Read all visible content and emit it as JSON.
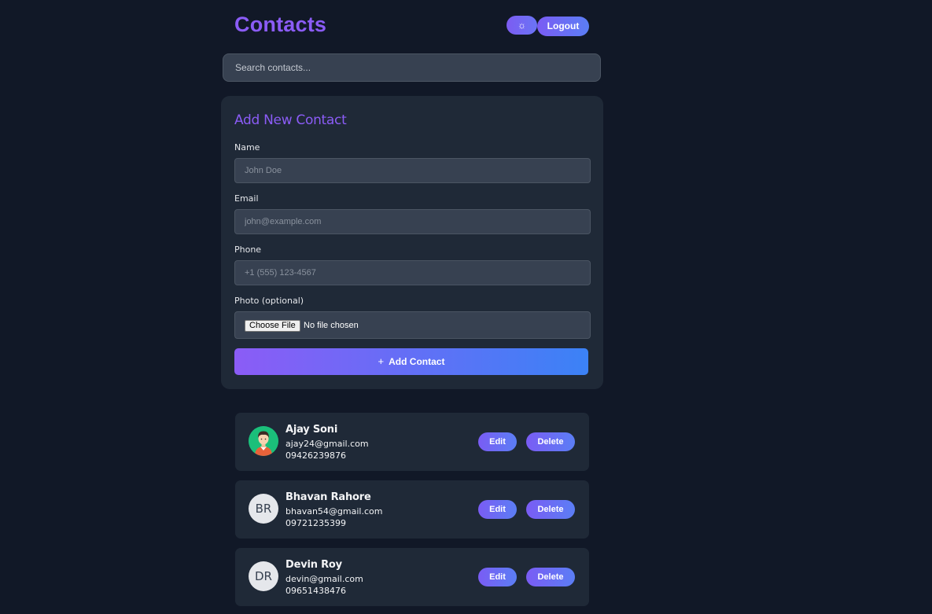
{
  "header": {
    "title": "Contacts",
    "theme_icon": "☼",
    "logout_label": "Logout"
  },
  "search": {
    "placeholder": "Search contacts..."
  },
  "form": {
    "title": "Add New Contact",
    "name_label": "Name",
    "name_placeholder": "John Doe",
    "email_label": "Email",
    "email_placeholder": "john@example.com",
    "phone_label": "Phone",
    "phone_placeholder": "+1 (555) 123-4567",
    "photo_label": "Photo (optional)",
    "choose_file_label": "Choose File",
    "no_file_text": "No file chosen",
    "submit_icon": "+",
    "submit_label": "Add Contact"
  },
  "contacts": [
    {
      "name": "Ajay Soni",
      "email": "ajay24@gmail.com",
      "phone": "09426239876",
      "avatar_type": "photo",
      "initials": "",
      "edit_label": "Edit",
      "delete_label": "Delete"
    },
    {
      "name": "Bhavan Rahore",
      "email": "bhavan54@gmail.com",
      "phone": "09721235399",
      "avatar_type": "initials",
      "initials": "BR",
      "edit_label": "Edit",
      "delete_label": "Delete"
    },
    {
      "name": "Devin Roy",
      "email": "devin@gmail.com",
      "phone": "09651438476",
      "avatar_type": "initials",
      "initials": "DR",
      "edit_label": "Edit",
      "delete_label": "Delete"
    }
  ],
  "colors": {
    "background": "#111827",
    "card": "#1f2937",
    "accent_purple": "#8b5cf6",
    "accent_blue": "#3b82f6"
  }
}
